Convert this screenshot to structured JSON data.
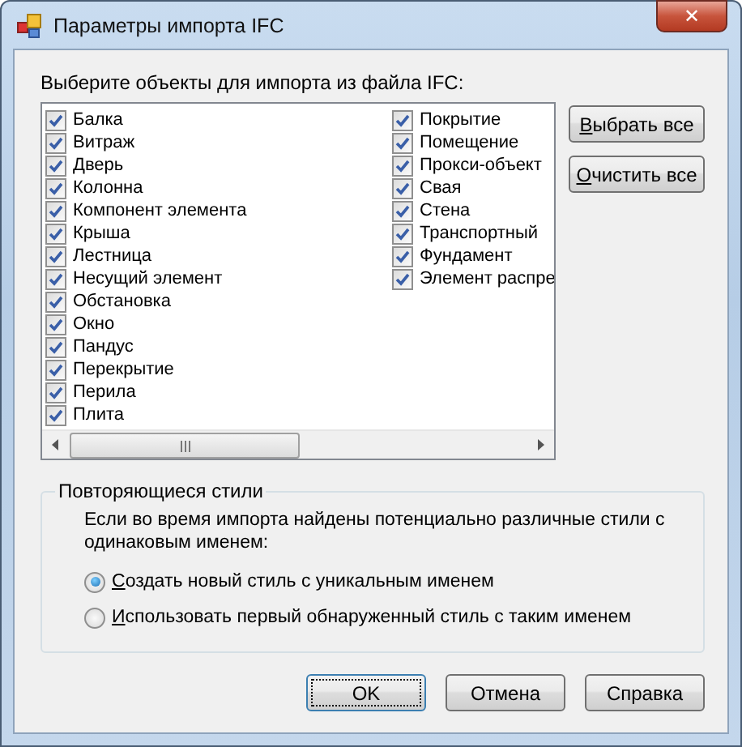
{
  "window": {
    "title": "Параметры импорта IFC",
    "close": "✕"
  },
  "prompt": "Выберите объекты для импорта из файла IFC:",
  "objects": [
    {
      "label": "Балка",
      "checked": true
    },
    {
      "label": "Витраж",
      "checked": true
    },
    {
      "label": "Дверь",
      "checked": true
    },
    {
      "label": "Колонна",
      "checked": true
    },
    {
      "label": "Компонент элемента",
      "checked": true
    },
    {
      "label": "Крыша",
      "checked": true
    },
    {
      "label": "Лестница",
      "checked": true
    },
    {
      "label": "Несущий элемент",
      "checked": true
    },
    {
      "label": "Обстановка",
      "checked": true
    },
    {
      "label": "Окно",
      "checked": true
    },
    {
      "label": "Пандус",
      "checked": true
    },
    {
      "label": "Перекрытие",
      "checked": true
    },
    {
      "label": "Перила",
      "checked": true
    },
    {
      "label": "Плита",
      "checked": true
    },
    {
      "label": "Покрытие",
      "checked": true
    },
    {
      "label": "Помещение",
      "checked": true
    },
    {
      "label": "Прокси-объект",
      "checked": true
    },
    {
      "label": "Свая",
      "checked": true
    },
    {
      "label": "Стена",
      "checked": true
    },
    {
      "label": "Транспортный",
      "checked": true
    },
    {
      "label": "Фундамент",
      "checked": true
    },
    {
      "label": "Элемент распре",
      "checked": true
    }
  ],
  "side_buttons": [
    {
      "key": "В",
      "rest": "ыбрать все"
    },
    {
      "key": "О",
      "rest": "чистить все"
    }
  ],
  "styles_group": {
    "title": "Повторяющиеся стили",
    "text": "Если во время импорта найдены потенциально различные стили с одинаковым именем:",
    "options": [
      {
        "key": "С",
        "rest": "оздать новый стиль с уникальным именем",
        "selected": true
      },
      {
        "key": "И",
        "rest": "спользовать первый обнаруженный стиль с таким именем",
        "selected": false
      }
    ]
  },
  "buttons": [
    {
      "label": "OK",
      "kind": "default"
    },
    {
      "label": "Отмена",
      "kind": "normal"
    },
    {
      "label": "Справка",
      "kind": "normal"
    }
  ]
}
